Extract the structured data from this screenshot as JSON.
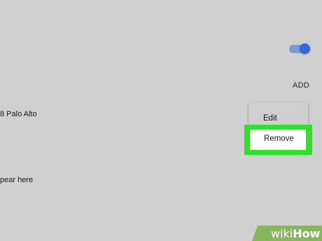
{
  "settings": {
    "toggle_state": "on",
    "add_label": "ADD"
  },
  "addresses": {
    "item_text": "8 Palo Alto",
    "empty_text": "pear here"
  },
  "context_menu": {
    "edit_label": "Edit",
    "remove_label": "Remove"
  },
  "watermark": {
    "part1": "wiki",
    "part2": "How"
  },
  "colors": {
    "accent_blue": "#2f6ad3",
    "highlight_green": "#2fe02a",
    "badge_green": "#8ab560"
  }
}
